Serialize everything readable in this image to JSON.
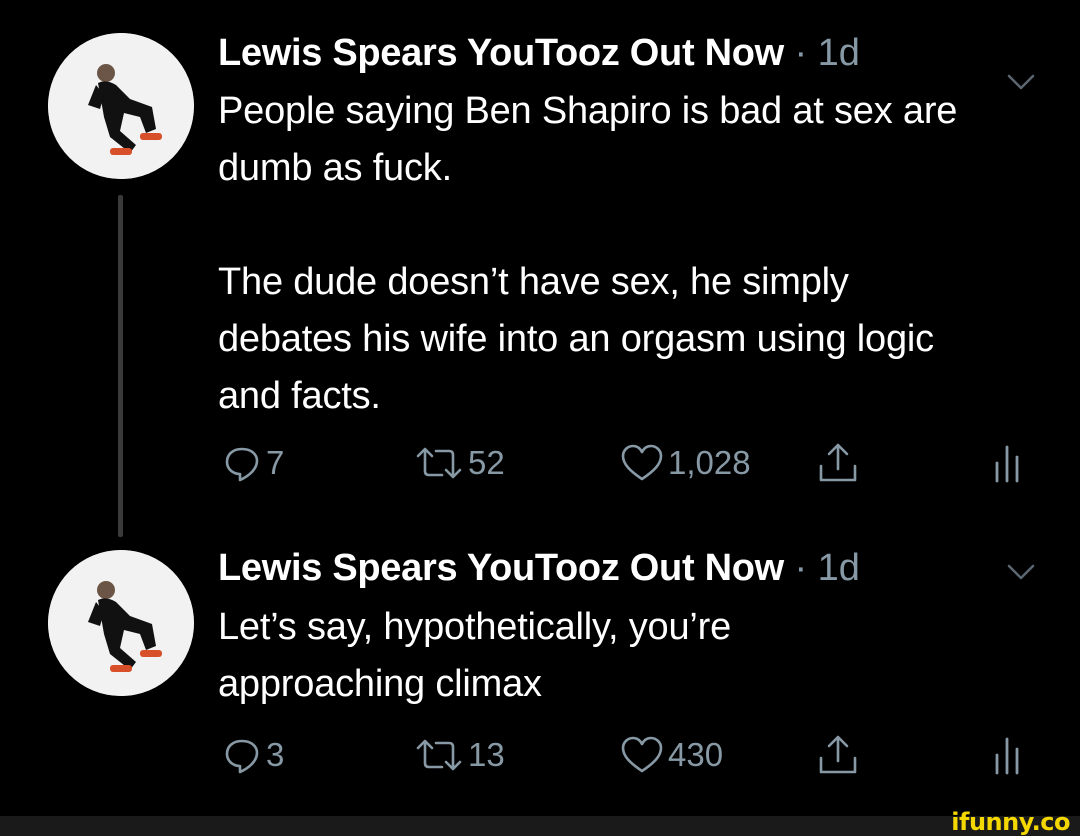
{
  "tweets": [
    {
      "author": "Lewis Spears YouTooz Out Now",
      "separator": "·",
      "time": "1d",
      "paragraphs": [
        "People saying Ben Shapiro is bad at sex are dumb as fuck.",
        "The dude doesn’t have sex, he simply debates his wife into an orgasm using logic and facts."
      ],
      "stats": {
        "replies": "7",
        "retweets": "52",
        "likes": "1,028"
      }
    },
    {
      "author": "Lewis Spears YouTooz Out Now",
      "separator": "·",
      "time": "1d",
      "paragraphs": [
        "Let’s say, hypothetically, you’re approaching climax"
      ],
      "stats": {
        "replies": "3",
        "retweets": "13",
        "likes": "430"
      }
    }
  ],
  "watermark": "ifunny.co",
  "colors": {
    "background": "#000000",
    "text": "#ffffff",
    "secondary": "#8899a6",
    "thread_line": "#3a3a3a",
    "watermark": "#f5d700"
  },
  "icons": [
    "reply-icon",
    "retweet-icon",
    "like-icon",
    "share-icon",
    "analytics-icon",
    "chevron-down-icon"
  ]
}
